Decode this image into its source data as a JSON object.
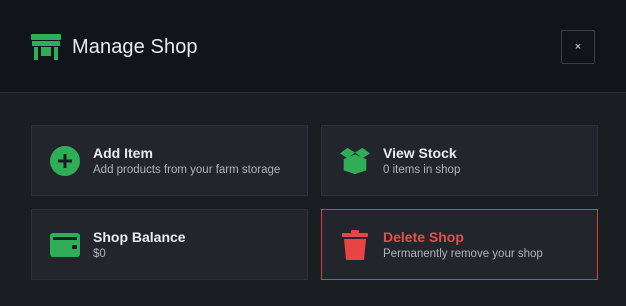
{
  "header": {
    "title": "Manage Shop",
    "icon": "store-icon",
    "close_label": "×"
  },
  "actions": [
    {
      "label": "Add Item",
      "description": "Add products from your farm storage",
      "icon": "plus-circle-icon"
    },
    {
      "label": "View Stock",
      "description": "0 items in shop",
      "icon": "box-open-icon"
    },
    {
      "label": "Shop Balance",
      "description": "$0",
      "icon": "wallet-icon"
    },
    {
      "label": "Delete Shop",
      "description": "Permanently remove your shop",
      "icon": "trash-icon"
    }
  ],
  "colors": {
    "accent": "#2fae57",
    "danger": "#e84444",
    "background": "#1a1d22",
    "header_background": "#111418",
    "card_background": "#22262c"
  }
}
